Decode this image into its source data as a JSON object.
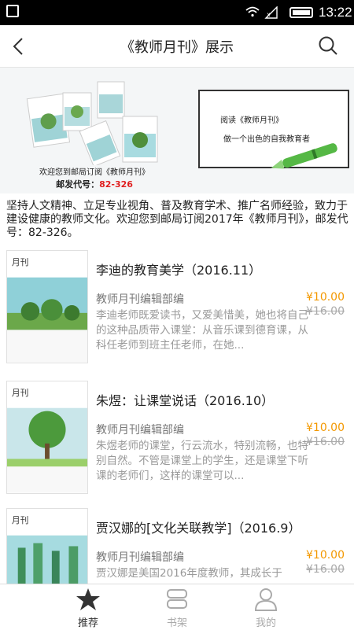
{
  "status_bar": {
    "time": "13:22"
  },
  "header": {
    "title": "《教师月刊》展示"
  },
  "banner": {
    "caption_line1": "欢迎您到邮局订阅《教师月刊》",
    "caption_line2_prefix": "邮发代号：",
    "caption_code": "82-326",
    "frame_line1": "阅读《教师月刊》",
    "frame_line2": "做一个出色的自我教育者"
  },
  "intro": "坚持人文精神、立足专业视角、普及教育学术、推广名师经验，致力于建设健康的教师文化。欢迎您到邮局订阅2017年《教师月刊》，邮发代号：82-326。",
  "items": [
    {
      "title": "李迪的教育美学（2016.11）",
      "author": "教师月刊编辑部编",
      "desc": "李迪老师既爱读书，又爱美惜美，她也将自己的这种品质带入课堂：从音乐课到德育课，从科任老师到班主任老师，在她...",
      "price": "¥10.00",
      "original_price": "¥16.00"
    },
    {
      "title": "朱煜：让课堂说话（2016.10）",
      "author": "教师月刊编辑部编",
      "desc": "朱煜老师的课堂，行云流水，特别流畅，也特别自然。不管是课堂上的学生，还是课堂下听课的老师们，这样的课堂可以...",
      "price": "¥10.00",
      "original_price": "¥16.00"
    },
    {
      "title": "贾汉娜的[文化关联教学]（2016.9）",
      "author": "教师月刊编辑部编",
      "desc": "贾汉娜是美国2016年度教师，其成长于",
      "price": "¥10.00",
      "original_price": "¥16.00"
    }
  ],
  "tabbar": {
    "tabs": [
      {
        "label": "推荐",
        "icon": "star-icon",
        "active": true
      },
      {
        "label": "书架",
        "icon": "bookshelf-icon",
        "active": false
      },
      {
        "label": "我的",
        "icon": "person-icon",
        "active": false
      }
    ]
  },
  "colors": {
    "price": "#f39800",
    "active_tab": "#333333",
    "inactive_tab": "#aaaaaa"
  }
}
